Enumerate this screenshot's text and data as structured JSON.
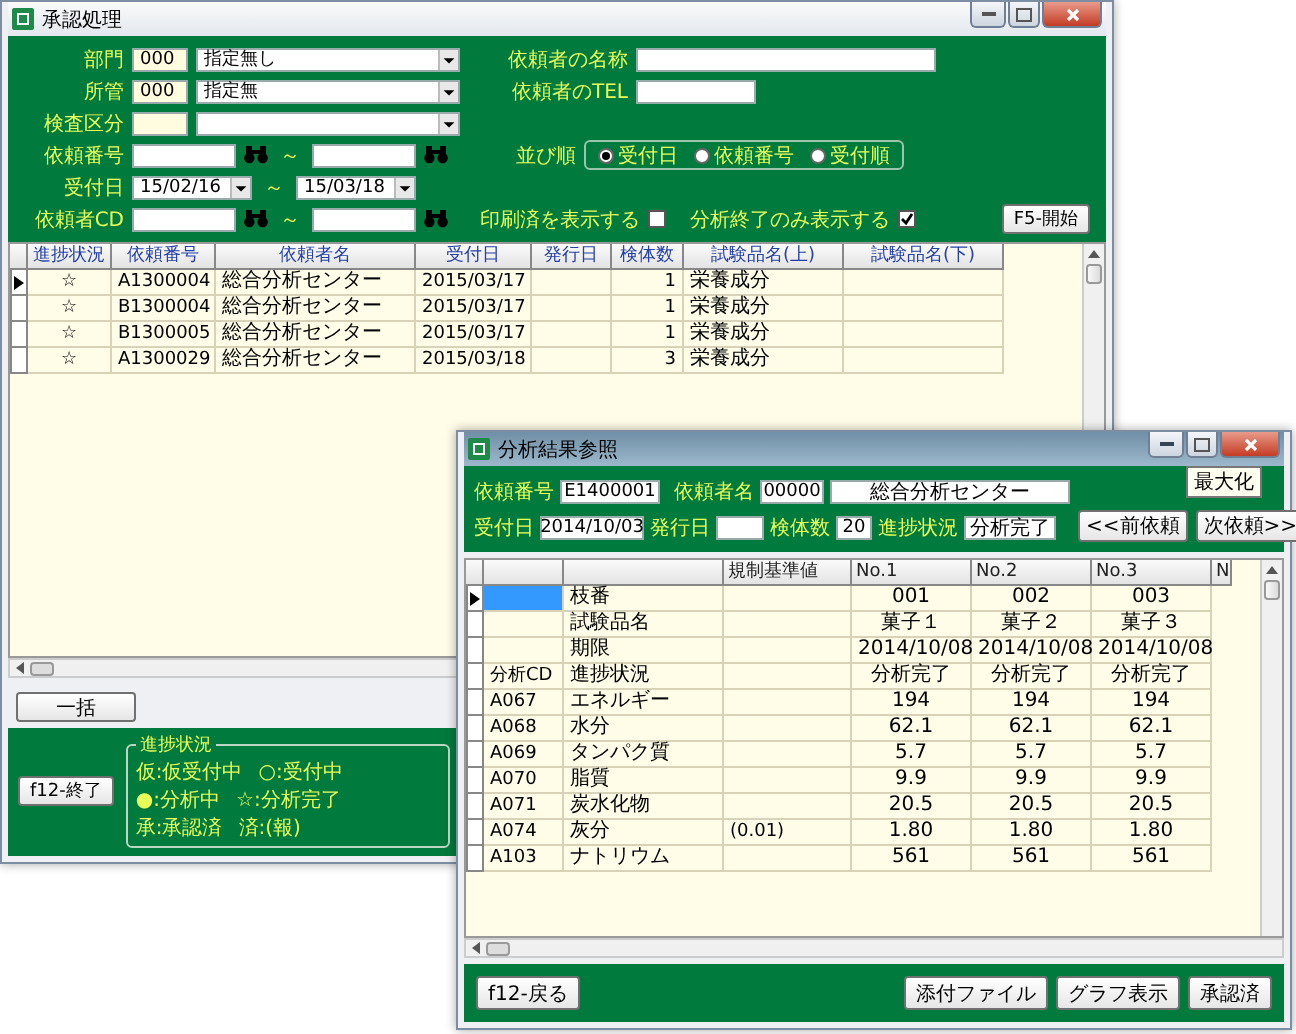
{
  "main_window": {
    "title": "承認処理",
    "department": {
      "label": "部門",
      "code": "000",
      "value": "指定無し"
    },
    "jurisdiction": {
      "label": "所管",
      "code": "000",
      "value": "指定無"
    },
    "inspection_type": {
      "label": "検査区分"
    },
    "requester_name": {
      "label": "依頼者の名称"
    },
    "requester_tel": {
      "label": "依頼者のTEL"
    },
    "request_no": {
      "label": "依頼番号",
      "tilde": "～"
    },
    "received_date": {
      "label": "受付日",
      "from": "15/02/16",
      "tilde": "～",
      "to": "15/03/18"
    },
    "requester_cd": {
      "label": "依頼者CD",
      "tilde": "～"
    },
    "sort_order": {
      "label": "並び順",
      "options": [
        {
          "label": "受付日",
          "selected": true
        },
        {
          "label": "依頼番号",
          "selected": false
        },
        {
          "label": "受付順",
          "selected": false
        }
      ]
    },
    "show_printed": {
      "label": "印刷済を表示する",
      "checked": false
    },
    "only_finished": {
      "label": "分析終了のみ表示する",
      "checked": true
    },
    "start_button": "F5-開始",
    "table": {
      "columns": [
        "進捗状況",
        "依頼番号",
        "依頼者名",
        "受付日",
        "発行日",
        "検体数",
        "試験品名(上)",
        "試験品名(下)"
      ],
      "rows": [
        {
          "selected": true,
          "status": "☆",
          "request_no": "A1300004",
          "requester": "総合分析センター",
          "received": "2015/03/17",
          "samples": "1",
          "item_upper": "栄養成分"
        },
        {
          "selected": false,
          "status": "☆",
          "request_no": "B1300004",
          "requester": "総合分析センター",
          "received": "2015/03/17",
          "samples": "1",
          "item_upper": "栄養成分"
        },
        {
          "selected": false,
          "status": "☆",
          "request_no": "B1300005",
          "requester": "総合分析センター",
          "received": "2015/03/17",
          "samples": "1",
          "item_upper": "栄養成分"
        },
        {
          "selected": false,
          "status": "☆",
          "request_no": "A1300029",
          "requester": "総合分析センター",
          "received": "2015/03/18",
          "samples": "3",
          "item_upper": "栄養成分"
        }
      ]
    },
    "bulk_button": "一括",
    "exit_button": "f12-終了",
    "legend": {
      "title": "進捗状況",
      "items": [
        {
          "symbol": "仮",
          "label": ":仮受付中"
        },
        {
          "symbol": "○",
          "label": ":受付中"
        },
        {
          "symbol": "●",
          "label": ":分析中"
        },
        {
          "symbol": "☆",
          "label": ":分析完了"
        },
        {
          "symbol": "承",
          "label": ":承認済"
        },
        {
          "symbol": "済",
          "label": ":(報)"
        }
      ]
    }
  },
  "result_window": {
    "title": "分析結果参照",
    "tooltip": "最大化",
    "request_no": {
      "label": "依頼番号",
      "value": "E1400001"
    },
    "requester": {
      "label": "依頼者名",
      "code": "00000",
      "name": "総合分析センター"
    },
    "received": {
      "label": "受付日",
      "value": "2014/10/03"
    },
    "issued": {
      "label": "発行日"
    },
    "samples": {
      "label": "検体数",
      "value": "20"
    },
    "progress": {
      "label": "進捗状況",
      "value": "分析完了"
    },
    "prev_button": "<<前依頼",
    "next_button": "次依頼>>",
    "table": {
      "columns": [
        "規制基準値",
        "No.1",
        "No.2",
        "No.3",
        "N"
      ],
      "rows": [
        {
          "selected": true,
          "name": "枝番",
          "values": [
            "001",
            "002",
            "003"
          ]
        },
        {
          "selected": false,
          "name": "試験品名",
          "values": [
            "菓子１",
            "菓子２",
            "菓子３"
          ]
        },
        {
          "selected": false,
          "name": "期限",
          "values": [
            "2014/10/08",
            "2014/10/08",
            "2014/10/08"
          ]
        },
        {
          "selected": false,
          "code": "分析CD",
          "name": "進捗状況",
          "values": [
            "分析完了",
            "分析完了",
            "分析完了"
          ]
        },
        {
          "selected": false,
          "code": "A067",
          "name": "エネルギー",
          "values": [
            "194",
            "194",
            "194"
          ]
        },
        {
          "selected": false,
          "code": "A068",
          "name": "水分",
          "values": [
            "62.1",
            "62.1",
            "62.1"
          ]
        },
        {
          "selected": false,
          "code": "A069",
          "name": "タンパク質",
          "values": [
            "5.7",
            "5.7",
            "5.7"
          ]
        },
        {
          "selected": false,
          "code": "A070",
          "name": "脂質",
          "values": [
            "9.9",
            "9.9",
            "9.9"
          ]
        },
        {
          "selected": false,
          "code": "A071",
          "name": "炭水化物",
          "values": [
            "20.5",
            "20.5",
            "20.5"
          ]
        },
        {
          "selected": false,
          "code": "A074",
          "name": "灰分",
          "standard": "(0.01)",
          "values": [
            "1.80",
            "1.80",
            "1.80"
          ]
        },
        {
          "selected": false,
          "code": "A103",
          "name": "ナトリウム",
          "values": [
            "561",
            "561",
            "561"
          ]
        }
      ]
    },
    "back_button": "f12-戻る",
    "action_buttons": [
      "添付ファイル",
      "グラフ表示",
      "承認済"
    ]
  }
}
